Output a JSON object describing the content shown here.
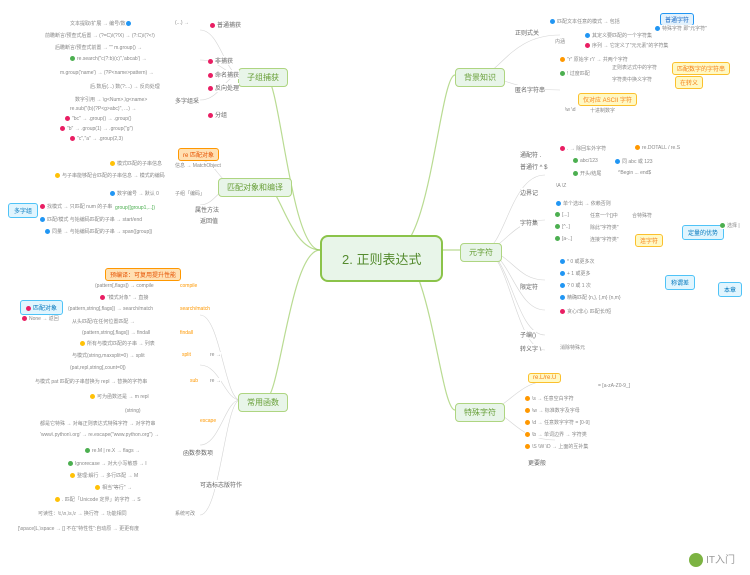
{
  "title": "2. 正则表达式",
  "watermark": "IT入门",
  "branches": {
    "tr": "背景知识",
    "r": "元字符",
    "br": "特殊字符",
    "tl": "子组捕获",
    "ml": "匹配对象和编译",
    "bl": "常用函数"
  },
  "side": {
    "left_top": "多字组",
    "left_mid": "匹配对象",
    "right_mid": "定量的优势",
    "right_lower": "称谓差",
    "right_far": "本章"
  },
  "tags": {
    "re": "re 匹配对象",
    "compile": "预编译：可复用提升性能",
    "ascii": "仅对应 ASCII 字符",
    "meta": "连字符",
    "num_metamatch": "匹配数字的字符串",
    "win": "在转义",
    "rel": "re.L/re.U"
  },
  "tr": {
    "a": "正则式关",
    "b": "匹配文本任意的模式 → 包括",
    "c": "普通字符",
    "d": "特殊字符 即\"元字符\"",
    "e": "内涵",
    "f": "其定义要匹配的一个字符集",
    "g": "序列 → 它定义了\"元元素\"的字符集",
    "h": "匿名字符串",
    "i": "\"r\" 原始字 r'\\' → 共两个字符",
    "j": "! 过度匹配",
    "k": "正则表达式中的字符",
    "l": "字符类中换义字符",
    "m": "\\w \\d",
    "n": "十进制数字"
  },
  "r": {
    "a": "通配符 .",
    "b": ". → 除回车外字符",
    "c": "re.DOTALL / re.S",
    "d": "普通行 ^ $",
    "e": "abc/123",
    "f": "同 abc 或 123",
    "g": "开头/结尾",
    "h": "^Begin ... end$",
    "i": "边界记",
    "j": "\\A \\Z",
    "k": "字符集",
    "l": "单个选出 → 依赖否则",
    "m": "[...]",
    "n": "任意一个[]中",
    "o": "合特殊符",
    "p": "[^..]",
    "q": "除此\"字符类\"",
    "r": "[a-..]",
    "s": "连接\"字符类\"",
    "t": "限定符",
    "u": "* 0 或更多次",
    "v": "+ 1 或更多",
    "w": "? 0 或 1 次",
    "x": "精确匹配 {n,}, {,m} {n,m}",
    "y": "贪心/非心 匹配长/短",
    "z": "选择 |",
    "p1": "子编()",
    "p2": "转义字 \\",
    "p3": "消除特殊元"
  },
  "br": {
    "a": "\\s → 任意空白字符",
    "b": "= [a-zA-Z0-9_]",
    "c": "\\w → 标准数字及字母",
    "d": "\\d → 任意数字字符 = [0-9]",
    "e": "\\b → 单词边界 → 字符类",
    "f": "\\S \\W \\D → 上面的互补集",
    "g": "更要般"
  },
  "tl": {
    "a": "(...) →",
    "b": "普通捕获",
    "c": "文本提取/扩展 → 编号/数",
    "d": "前瞻断言/预查式后置 → (?=C)/(?!X) → (?:C)/(?<!)",
    "e": "后瞻断言/预查式前置 → \"\" m.group() →",
    "f": "re.search(\"c(?:b)(c)\",'abcab') →",
    "g": "非捕获",
    "h": "m.group('name') → (?P<name>pattern) →",
    "i": "命名捕获",
    "j": "后.数后(...) 数(?:...) → 反向处理",
    "k": "数字引用 → \\g<Num>,\\g<name>",
    "l": "多字组采",
    "m": "re.sub(\"(b)(?P<g>abc)\", ...) →",
    "n": "分组",
    "o": "\"bc\" → .group() → .group()",
    "p": "\"b\" → .group(1) → .group(\"g\")",
    "q": "\"c\",\"a\" → .group(2,3)"
  },
  "ml": {
    "a": "信息 → MatchObject",
    "b": "模式匹配的子串信息",
    "c": "与子串能够配合匹配的子串信息 → 模式的编码",
    "d": "数字编号 → 默认 0",
    "e": "子组「编码」",
    "f": "group([group1,...])",
    "g": "找模式 → 只匹配 num 的子串",
    "h": "属性方法",
    "i": "匹配/模式 与始编码匹配的子串 → start/end",
    "j": "返回值",
    "k": "同量 → 与始编码匹配的子串 → span([group])"
  },
  "bl": {
    "a": "(pattern[,flags]) → compile",
    "b": "\"模式对象\" → 直接",
    "c": "(pattern,string[,flags]) → search/match",
    "d": "None → 返回",
    "e": "从头匹配/在任何位置匹配 →",
    "f": "(pattern,string[,flags]) → findall",
    "g": "所有与模式匹配的子串 → 列表",
    "h": "与模式(string,maxsplit=0) → split",
    "i": "(pat,repl,string[,count=0])",
    "j": "re →",
    "k": "sub",
    "l": "与模式 pat 匹配的子串替换为 repl → 替换的字符串",
    "m": "re →",
    "n": "可为函数还是 → m repl",
    "o": "(string)",
    "p": "escape",
    "q": "都是它特殊 → 对每正则表达式特殊字符 → 对字符串",
    "r": "'www\\.python\\.org' → re.escape(\"www.python.org\") →",
    "s": "re.M | re.X → flags →",
    "t": "函数参数项",
    "u": "Ignorecase → 对大小写敏感 → I",
    "v": "整理:解行 → 多行匹配 → M",
    "w": "相当\"等行\" →",
    "x": ". 匹配「Unicode 定界」的字符 → S",
    "y": "可选标志版符作",
    "z": "可读性：\\t,\\n,\\s,\\r → 换行符 → 功能相同",
    "z1": "系统可改",
    "z2": "[\\space]L,\\space → [] 不在\"特性性\":自动原 → 更更有度"
  }
}
